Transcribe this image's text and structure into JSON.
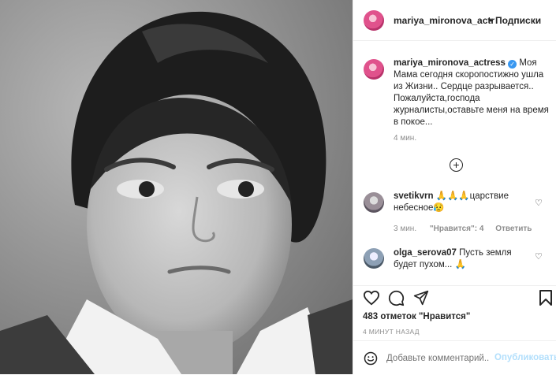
{
  "post": {
    "photo_alt": ""
  },
  "header": {
    "username": "mariya_mironova_actr",
    "separator": "•",
    "follow_label": "Подписки"
  },
  "caption": {
    "username": "mariya_mironova_actress",
    "text_first": "Моя",
    "text_lines": [
      "Мама сегодня скоропостижно ушла",
      "из Жизни.. Сердце разрывается..",
      "Пожалуйста,господа",
      "журналисты,оставьте меня на время",
      "в покое..."
    ],
    "time": "4 мин."
  },
  "comments": [
    {
      "username": "svetikvrn",
      "text_line1": "🙏🙏🙏царствие",
      "text_line2": "небесное😥",
      "time": "3 мин.",
      "likes_label": "\"Нравится\": 4",
      "reply_label": "Ответить"
    },
    {
      "username": "olga_serova07",
      "text_line1": "Пусть земля",
      "text_line2": "будет пухом... 🙏"
    }
  ],
  "stats": {
    "likes": "483 отметок \"Нравится\"",
    "posted": "4 МИНУТ НАЗАД"
  },
  "composer": {
    "placeholder": "Добавьте комментарий...",
    "publish_label": "Опубликовать"
  },
  "colors": {
    "link": "#0095f6",
    "publish_disabled": "#b2dffc",
    "muted": "#8e8e8e",
    "verified": "#3897f0"
  }
}
